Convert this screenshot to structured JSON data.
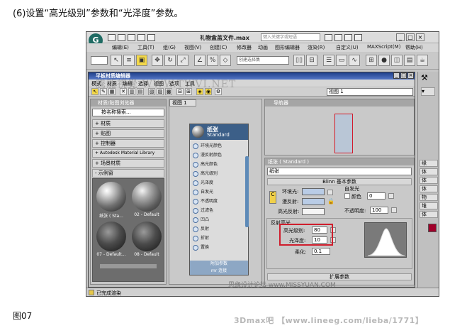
{
  "caption_top": "(6)设置“高光级别”参数和“光泽度”参数。",
  "caption_bottom": "图07",
  "footer": "3Dmax吧 【www.lineeg.com/lieba/1771】",
  "watermark_center": "騰龍視覺 WWW.TWVI.NET",
  "watermark_br": "思缘设计论坛 www.MISSYUAN.COM",
  "app": {
    "title": "礼物盒盖文件.max",
    "search_placeholder": "键入关键字或短语",
    "menu": [
      "编辑(E)",
      "工具(T)",
      "组(G)",
      "视图(V)",
      "创建(C)",
      "修改器",
      "动画",
      "图形编辑器",
      "渲染(R)",
      "自定义(U)",
      "MAXScript(M)",
      "帮助(H)"
    ],
    "toolbar_dropdown_1": "全部",
    "toolbar_dropdown_2": "视图",
    "toolbar_dropdown_3": "创建选择集",
    "status_text": "已完成渲染"
  },
  "slate": {
    "title": "平板材质编辑器",
    "menu": [
      "模式",
      "材质",
      "编辑",
      "选择",
      "视图",
      "选项",
      "工具"
    ],
    "view_select": "视图 1",
    "browser": {
      "header": "材质/贴图浏览器",
      "search_placeholder": "按名称搜索...",
      "categories": [
        "+ 材质",
        "+ 贴图",
        "+ 控制器",
        "+ Autodesk Material Library",
        "+ 场景材质",
        "- 示例窗"
      ],
      "samples": [
        {
          "label": "纸张 ( Sta..."
        },
        {
          "label": "02 - Default"
        },
        {
          "label": "07 - Default..."
        },
        {
          "label": "08 - Default"
        }
      ]
    },
    "view_tab": "视图 1",
    "node": {
      "name": "纸张",
      "type": "Standard",
      "slots": [
        "环境光颜色",
        "漫反射颜色",
        "高光颜色",
        "高光级别",
        "光泽度",
        "自发光",
        "不透明度",
        "过滤色",
        "凹凸",
        "反射",
        "折射",
        "置换"
      ],
      "footer_1": "附加参数",
      "footer_2": "mr 连接"
    },
    "navigator_header": "导航器",
    "params": {
      "header": "纸张 ( Standard )",
      "material_name": "纸张",
      "rollout_blinn": "Blinn 基本参数",
      "ambient_label": "环境光:",
      "diffuse_label": "漫反射:",
      "specular_label": "高光反射:",
      "self_illum_label": "自发光",
      "color_label": "颜色",
      "self_illum_value": "0",
      "opacity_label": "不透明度:",
      "opacity_value": "100",
      "specular_section": "反射高光",
      "spec_level_label": "高光级别:",
      "spec_level_value": "80",
      "glossiness_label": "光泽度:",
      "glossiness_value": "10",
      "soften_label": "柔化:",
      "soften_value": "0.1",
      "rollout_extended": "扩展参数"
    },
    "command_panel": [
      "缘",
      "体",
      "体",
      "体",
      "物",
      "堆",
      "体"
    ]
  },
  "colors": {
    "ambient": "#b9cce6",
    "diffuse": "#b9cce6",
    "specular": "#f5f5f5",
    "highlight_box": "#cf1d2c",
    "node_header": "#3c5f88",
    "cmd_red_swatch": "#a0002a"
  }
}
